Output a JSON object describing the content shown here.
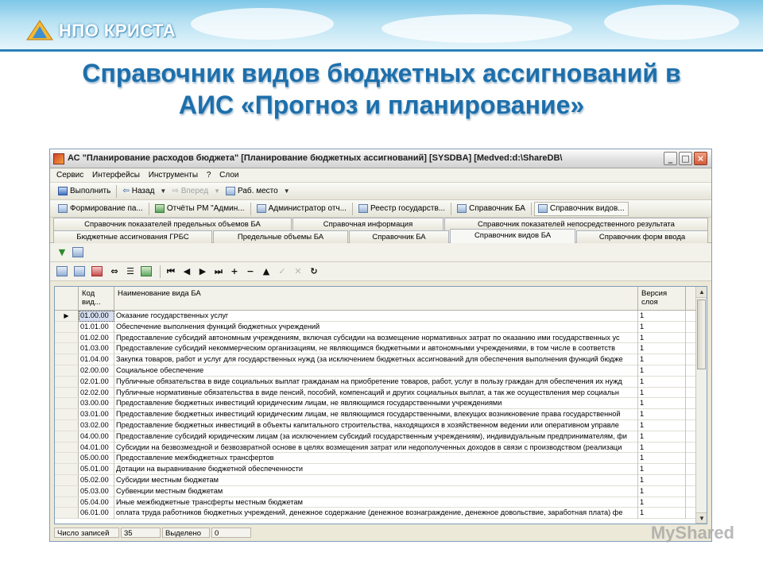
{
  "slide": {
    "logo_text": "НПО КРИСТА",
    "title_line1": "Справочник видов бюджетных ассигнований в",
    "title_line2": "АИС «Прогноз и планирование»"
  },
  "window": {
    "title": "АС \"Планирование расходов бюджета\" [Планирование бюджетных ассигнований] [SYSDBA] [Medved:d:\\ShareDB\\",
    "minimize": "_",
    "maximize": "□",
    "close": "×"
  },
  "menu": [
    "Сервис",
    "Интерфейсы",
    "Инструменты",
    "?",
    "Слои"
  ],
  "toolbar": {
    "run": "Выполнить",
    "back": "Назад",
    "forward": "Вперед",
    "workspace": "Раб. место"
  },
  "quicklinks": [
    "Формирование па...",
    "Отчёты РМ \"Админ...",
    "Администратор отч...",
    "Реестр государств...",
    "Справочник БА",
    "Справочник видов..."
  ],
  "tabs_row1": [
    "Справочник показателей предельных объемов БА",
    "Справочная информация",
    "Справочник показателей непосредственного результата"
  ],
  "tabs_row2": [
    "Бюджетные ассигнования ГРБС",
    "Предельные объемы БА",
    "Справочник БА",
    "Справочник видов БА",
    "Справочник форм ввода"
  ],
  "grid": {
    "col_code": "Код вид...",
    "col_name": "Наименование вида БА",
    "col_version": "Версия слоя",
    "rows": [
      {
        "code": "01.00.00",
        "name": "Оказание государственных услуг",
        "ver": "1"
      },
      {
        "code": "01.01.00",
        "name": "Обеспечение выполнения функций бюджетных учреждений",
        "ver": "1"
      },
      {
        "code": "01.02.00",
        "name": "Предоставление субсидий автономным учреждениям, включая субсидии на возмещение нормативных затрат по оказанию ими государственных ус",
        "ver": "1"
      },
      {
        "code": "01.03.00",
        "name": "Предоставление субсидий некоммерческим организациям, не являющимся бюджетными и автономными учреждениями, в том числе в соответств",
        "ver": "1"
      },
      {
        "code": "01.04.00",
        "name": "Закупка товаров, работ и услуг для государственных нужд (за исключением бюджетных ассигнований для обеспечения выполнения функций бюдже",
        "ver": "1"
      },
      {
        "code": "02.00.00",
        "name": "Социальное обеспечение",
        "ver": "1"
      },
      {
        "code": "02.01.00",
        "name": "Публичные обязательства в виде социальных выплат гражданам на приобретение товаров, работ, услуг в пользу граждан для обеспечения их нужд",
        "ver": "1"
      },
      {
        "code": "02.02.00",
        "name": "Публичные нормативные обязательства в виде пенсий, пособий, компенсаций и других социальных выплат, а так же осуществления мер социальн",
        "ver": "1"
      },
      {
        "code": "03.00.00",
        "name": "Предоставление бюджетных инвестиций юридическим лицам, не являющимся государственными учреждениями",
        "ver": "1"
      },
      {
        "code": "03.01.00",
        "name": "Предоставление бюджетных инвестиций юридическим лицам, не являющимся государственными, влекущих возникновение права государственной",
        "ver": "1"
      },
      {
        "code": "03.02.00",
        "name": "Предоставление бюджетных инвестиций в объекты капитального строительства, находящихся в хозяйственном ведении или оперативном управле",
        "ver": "1"
      },
      {
        "code": "04.00.00",
        "name": "Предоставление субсидий юридическим лицам (за исключением субсидий государственным учреждениям), индивидуальным предпринимателям, фи",
        "ver": "1"
      },
      {
        "code": "04.01.00",
        "name": "Субсидии на безвозмездной и безвозвратной основе в целях возмещения затрат или недополученных доходов в связи с производством (реализаци",
        "ver": "1"
      },
      {
        "code": "05.00.00",
        "name": "Предоставление межбюджетных трансфертов",
        "ver": "1"
      },
      {
        "code": "05.01.00",
        "name": "Дотации на выравнивание бюджетной обеспеченности",
        "ver": "1"
      },
      {
        "code": "05.02.00",
        "name": "Субсидии местным бюджетам",
        "ver": "1"
      },
      {
        "code": "05.03.00",
        "name": "Субвенции местным бюджетам",
        "ver": "1"
      },
      {
        "code": "05.04.00",
        "name": "Иные межбюджетные трансферты местным бюджетам",
        "ver": "1"
      },
      {
        "code": "06.01.00",
        "name": "оплата труда работников бюджетных учреждений, денежное содержание (денежное вознаграждение, денежное довольствие, заработная плата) фе",
        "ver": "1"
      }
    ]
  },
  "status": {
    "records_label": "Число записей",
    "records_value": "35",
    "selected_label": "Выделено",
    "selected_value": "0"
  },
  "watermark": "MyShared"
}
